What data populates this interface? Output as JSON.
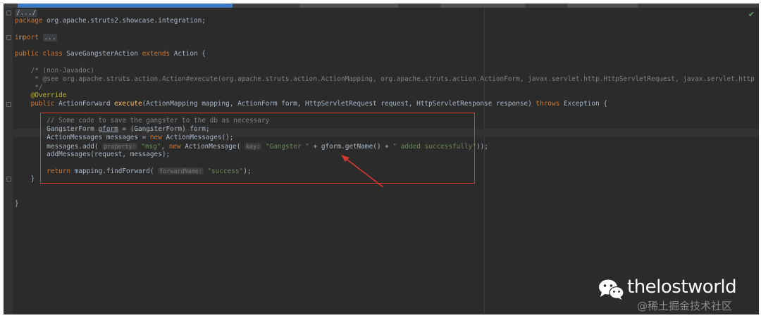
{
  "code": {
    "l1_fold": "/.../",
    "l2_kw": "package",
    "l2_rest": " org.apache.struts2.showcase.integration;",
    "l3_kw": "import",
    "l3_fold": "...",
    "l4_kw1": "public class",
    "l4_name": " SaveGangsterAction ",
    "l4_kw2": "extends",
    "l4_rest": " Action {",
    "l5": "    /* (non-Javadoc)",
    "l6": "     * @see org.apache.struts.action.Action#execute(org.apache.struts.action.ActionMapping, org.apache.struts.action.ActionForm, javax.servlet.http.HttpServletRequest, javax.servlet.http",
    "l7": "     */",
    "l8": "    @Override",
    "l9_kw": "    public",
    "l9_a": " ActionForward ",
    "l9_fn": "execute",
    "l9_b": "(ActionMapping mapping, ActionForm form, HttpServletRequest request, HttpServletResponse response) ",
    "l9_kw2": "throws",
    "l9_c": " Exception {",
    "l10": "        // Some code to save the gangster to the db as necessary",
    "l11_a": "        GangsterForm ",
    "l11_var": "gform",
    "l11_b": " = (GangsterForm) form;",
    "l12_a": "        ActionMessages messages = ",
    "l12_kw": "new",
    "l12_b": " ActionMessages();",
    "l13_a": "        messages.add( ",
    "l13_h1": "property:",
    "l13_s1": " \"msg\"",
    "l13_b": ", ",
    "l13_kw": "new",
    "l13_c": " ActionMessage( ",
    "l13_h2": "key:",
    "l13_s2": " \"Gangster \"",
    "l13_d": " + gform.getName() + ",
    "l13_s3": "\" added successfully\"",
    "l13_e": "));",
    "l14": "        addMessages(request, messages);",
    "l15_kw": "        return",
    "l15_a": " mapping.findForward( ",
    "l15_h": "forwardName:",
    "l15_s": " \"success\"",
    "l15_b": ");",
    "l16": "    }",
    "l17": "}"
  },
  "watermark": {
    "name": "thelostworld",
    "site": "@稀土掘金技术社区"
  },
  "colors": {
    "background": "#2b2b2b",
    "keyword": "#cc7832",
    "string": "#6a8759",
    "annotation": "#bbb529",
    "highlight": "#d8382f"
  }
}
